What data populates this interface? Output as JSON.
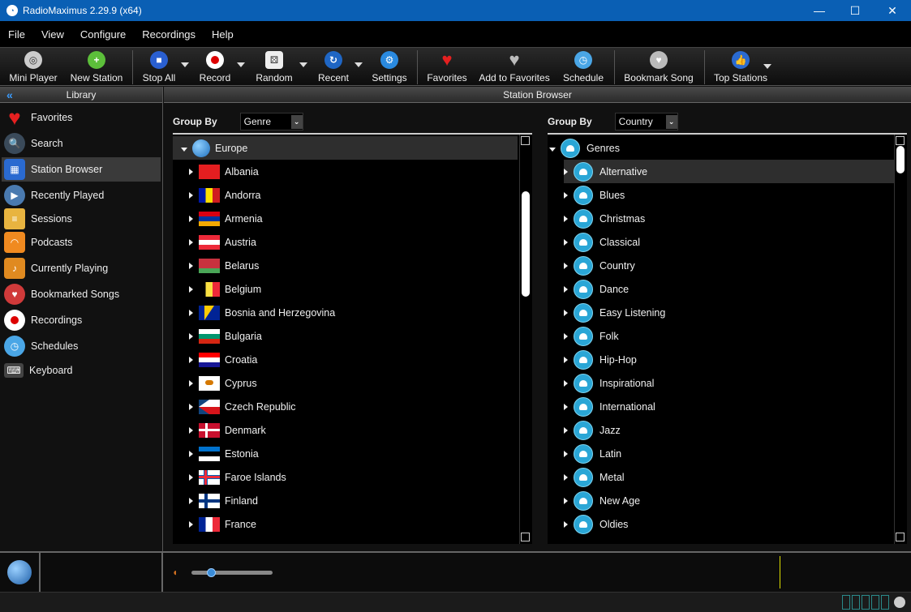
{
  "window": {
    "title": "RadioMaximus 2.29.9 (x64)"
  },
  "menu": [
    "File",
    "View",
    "Configure",
    "Recordings",
    "Help"
  ],
  "toolbar": {
    "mini_player": "Mini Player",
    "new_station": "New Station",
    "stop_all": "Stop All",
    "record": "Record",
    "random": "Random",
    "recent": "Recent",
    "settings": "Settings",
    "favorites": "Favorites",
    "add_to_favorites": "Add to Favorites",
    "schedule": "Schedule",
    "bookmark_song": "Bookmark Song",
    "top_stations": "Top Stations"
  },
  "library": {
    "title": "Library",
    "items": [
      "Favorites",
      "Search",
      "Station Browser",
      "Recently Played",
      "Sessions",
      "Podcasts",
      "Currently Playing",
      "Bookmarked Songs",
      "Recordings",
      "Schedules",
      "Keyboard"
    ]
  },
  "browser": {
    "title": "Station Browser",
    "left": {
      "group_by_label": "Group By",
      "group_by_value": "Genre",
      "root": "Europe",
      "items": [
        "Albania",
        "Andorra",
        "Armenia",
        "Austria",
        "Belarus",
        "Belgium",
        "Bosnia and Herzegovina",
        "Bulgaria",
        "Croatia",
        "Cyprus",
        "Czech Republic",
        "Denmark",
        "Estonia",
        "Faroe Islands",
        "Finland",
        "France"
      ]
    },
    "right": {
      "group_by_label": "Group By",
      "group_by_value": "Country",
      "root": "Genres",
      "items": [
        "Alternative",
        "Blues",
        "Christmas",
        "Classical",
        "Country",
        "Dance",
        "Easy Listening",
        "Folk",
        "Hip-Hop",
        "Inspirational",
        "International",
        "Jazz",
        "Latin",
        "Metal",
        "New Age",
        "Oldies"
      ]
    }
  },
  "colors": {
    "titlebar": "#0a5fb4",
    "accent": "#2aa6d6",
    "volume_knob": "#3a8cd8"
  }
}
